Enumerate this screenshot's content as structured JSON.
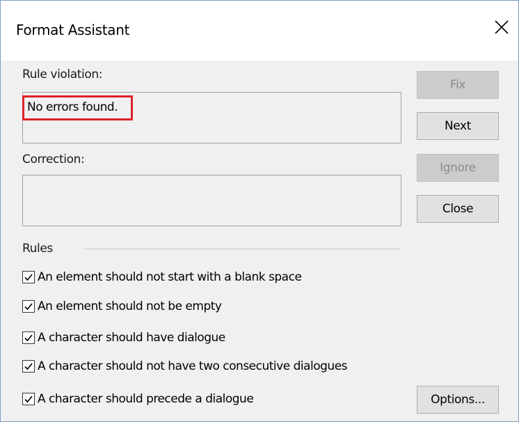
{
  "window": {
    "title": "Format Assistant",
    "close_icon": "close-icon"
  },
  "violation": {
    "label": "Rule violation:",
    "text": "No errors found.",
    "highlight_color": "#e0202a"
  },
  "correction": {
    "label": "Correction:",
    "text": ""
  },
  "buttons": {
    "fix": {
      "label": "Fix",
      "enabled": false
    },
    "next": {
      "label": "Next",
      "enabled": true
    },
    "ignore": {
      "label": "Ignore",
      "enabled": false
    },
    "close": {
      "label": "Close",
      "enabled": true
    },
    "options": {
      "label": "Options...",
      "enabled": true
    }
  },
  "rules": {
    "label": "Rules",
    "items": [
      {
        "label": "An element should not start with a blank space",
        "checked": true
      },
      {
        "label": "An element should not be empty",
        "checked": true
      },
      {
        "label": "A character should have dialogue",
        "checked": true
      },
      {
        "label": "A character should not have two consecutive dialogues",
        "checked": true
      },
      {
        "label": "A character should precede a dialogue",
        "checked": true
      }
    ]
  }
}
